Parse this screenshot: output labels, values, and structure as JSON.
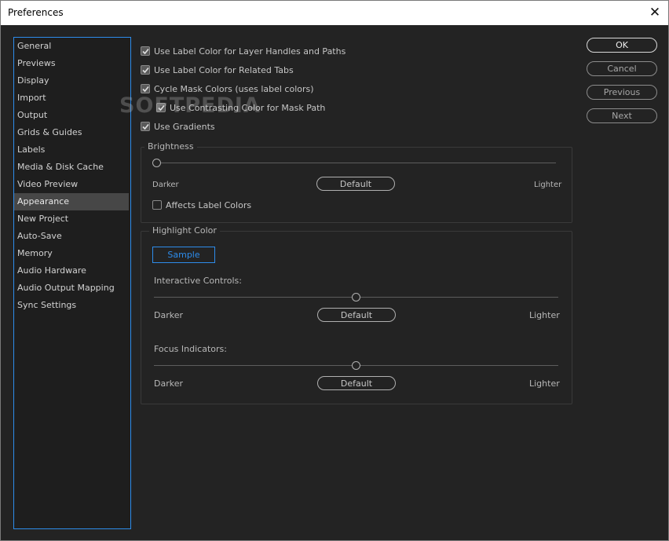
{
  "window": {
    "title": "Preferences",
    "close_glyph": "✕"
  },
  "sidebar": {
    "items": [
      {
        "label": "General"
      },
      {
        "label": "Previews"
      },
      {
        "label": "Display"
      },
      {
        "label": "Import"
      },
      {
        "label": "Output"
      },
      {
        "label": "Grids & Guides"
      },
      {
        "label": "Labels"
      },
      {
        "label": "Media & Disk Cache"
      },
      {
        "label": "Video Preview"
      },
      {
        "label": "Appearance",
        "selected": true
      },
      {
        "label": "New Project"
      },
      {
        "label": "Auto-Save"
      },
      {
        "label": "Memory"
      },
      {
        "label": "Audio Hardware"
      },
      {
        "label": "Audio Output Mapping"
      },
      {
        "label": "Sync Settings"
      }
    ]
  },
  "options": {
    "use_label_color_layer": {
      "label": "Use Label Color for Layer Handles and Paths",
      "checked": true
    },
    "use_label_color_tabs": {
      "label": "Use Label Color for Related Tabs",
      "checked": true
    },
    "cycle_mask_colors": {
      "label": "Cycle Mask Colors (uses label colors)",
      "checked": true
    },
    "use_contrasting_color": {
      "label": "Use Contrasting Color for Mask Path",
      "checked": true
    },
    "use_gradients": {
      "label": "Use Gradients",
      "checked": true
    }
  },
  "brightness": {
    "title": "Brightness",
    "darker": "Darker",
    "lighter": "Lighter",
    "default_label": "Default",
    "value_fraction": 0.0,
    "affects_label_colors": {
      "label": "Affects Label Colors",
      "checked": false
    }
  },
  "highlight": {
    "title": "Highlight Color",
    "sample_label": "Sample",
    "interactive": {
      "label": "Interactive Controls:",
      "darker": "Darker",
      "lighter": "Lighter",
      "default_label": "Default",
      "value_fraction": 0.5
    },
    "focus": {
      "label": "Focus Indicators:",
      "darker": "Darker",
      "lighter": "Lighter",
      "default_label": "Default",
      "value_fraction": 0.5
    }
  },
  "buttons": {
    "ok": "OK",
    "cancel": "Cancel",
    "previous": "Previous",
    "next": "Next"
  },
  "watermark": "SOFTPEDIA",
  "colors": {
    "accent": "#2d8ceb",
    "background": "#232323",
    "selected_item": "#474747"
  }
}
